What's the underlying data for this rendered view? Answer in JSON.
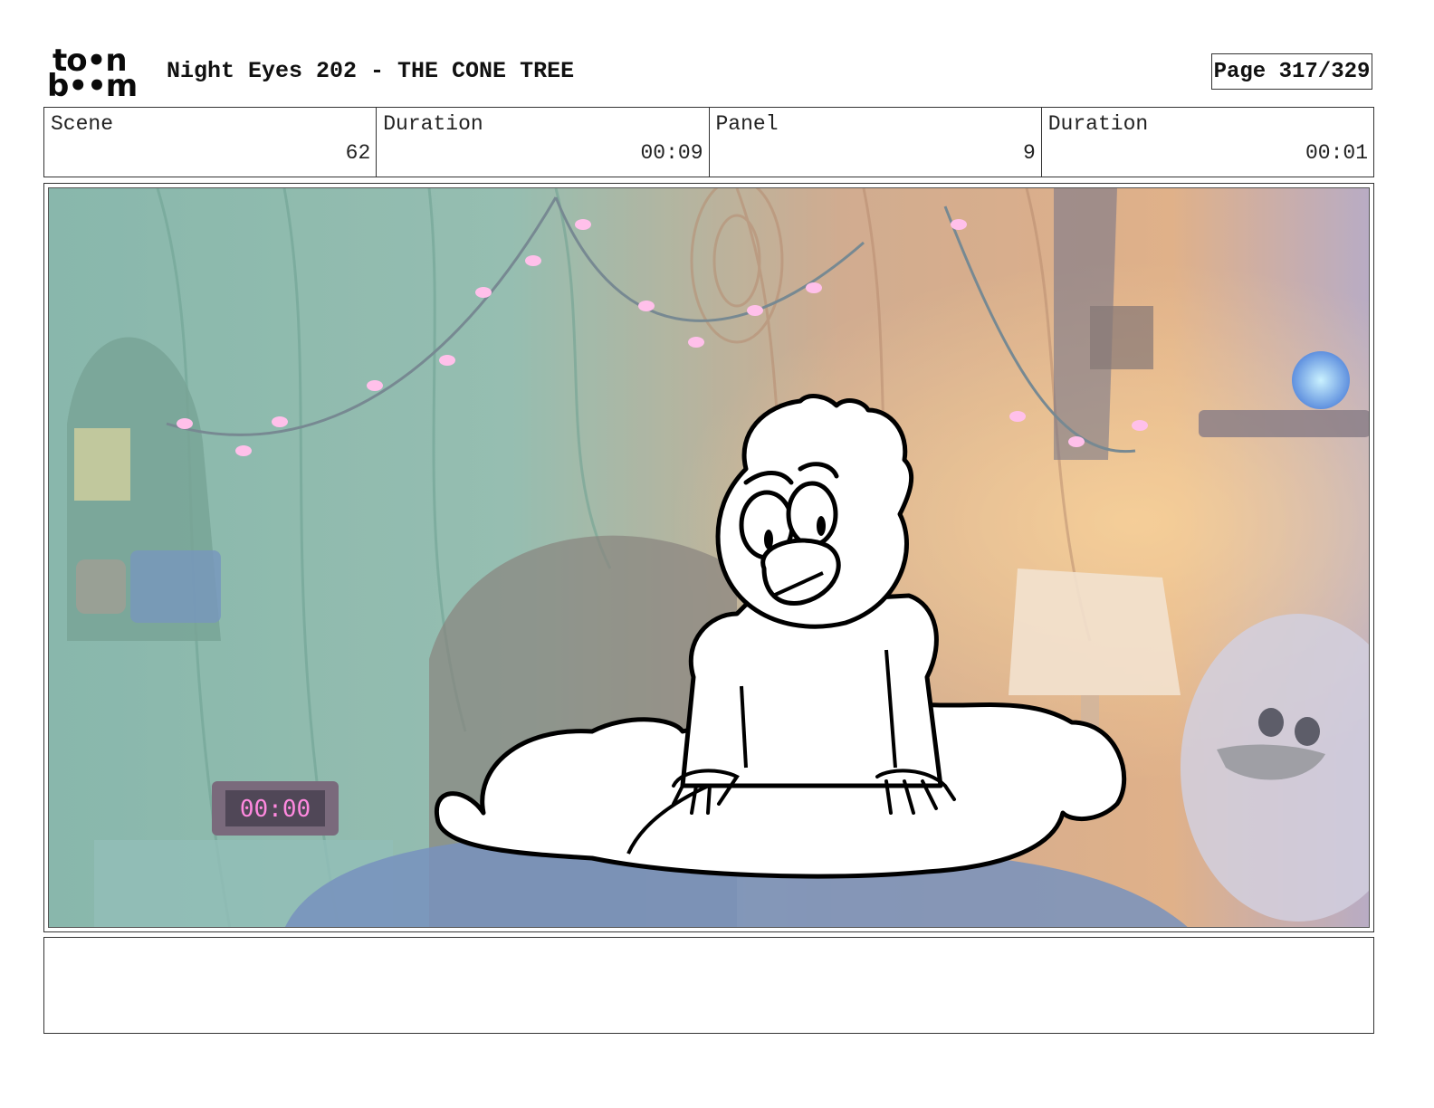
{
  "header": {
    "logo_line1": "to•n",
    "logo_line2": "b••m",
    "title": "Night Eyes 202 - THE CONE TREE",
    "page_label": "Page 317/329"
  },
  "info": {
    "scene_label": "Scene",
    "scene_value": "62",
    "scene_duration_label": "Duration",
    "scene_duration_value": "00:09",
    "panel_label": "Panel",
    "panel_value": "9",
    "panel_duration_label": "Duration",
    "panel_duration_value": "00:01"
  },
  "panel": {
    "clock_text": "00:00"
  },
  "notes": {
    "text": ""
  }
}
